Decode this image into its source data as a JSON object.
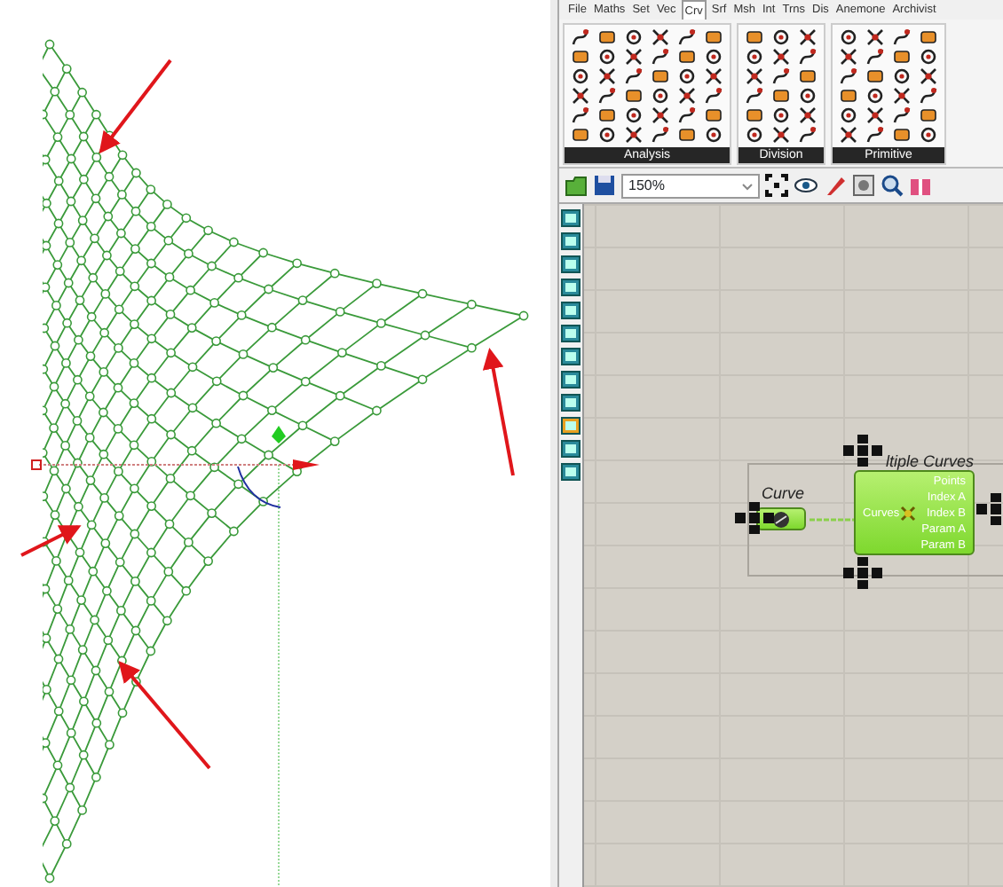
{
  "ribbon_tabs": [
    {
      "label": "File",
      "selected": false
    },
    {
      "label": "Maths",
      "selected": false
    },
    {
      "label": "Set",
      "selected": false
    },
    {
      "label": "Vec",
      "selected": false
    },
    {
      "label": "Crv",
      "selected": true
    },
    {
      "label": "Srf",
      "selected": false
    },
    {
      "label": "Msh",
      "selected": false
    },
    {
      "label": "Int",
      "selected": false
    },
    {
      "label": "Trns",
      "selected": false
    },
    {
      "label": "Dis",
      "selected": false
    },
    {
      "label": "Anemone",
      "selected": false
    },
    {
      "label": "Archivist",
      "selected": false
    }
  ],
  "ribbon_groups": [
    {
      "label": "Analysis"
    },
    {
      "label": "Division"
    },
    {
      "label": "Primitive"
    }
  ],
  "toolbar": {
    "zoom": "150%"
  },
  "components": [
    {
      "kind": "param",
      "title": "Curve"
    },
    {
      "kind": "component",
      "title": "ltiple Curves",
      "inputs": [
        "Curves"
      ],
      "outputs": [
        "Points",
        "Index A",
        "Index B",
        "Param A",
        "Param B"
      ]
    }
  ]
}
